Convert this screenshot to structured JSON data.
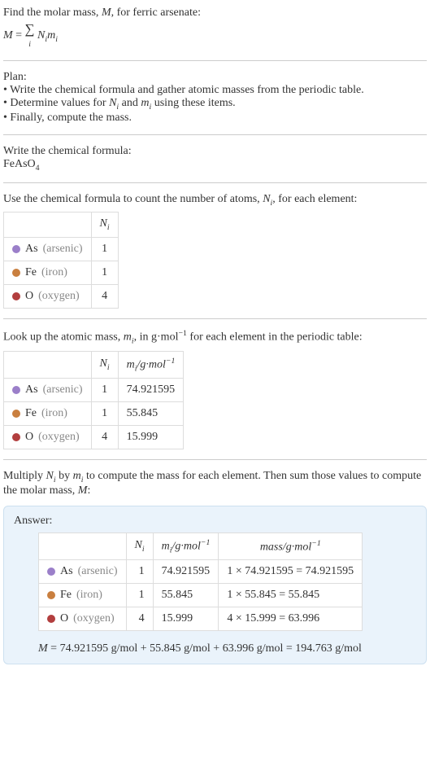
{
  "intro": {
    "title_pre": "Find the molar mass, ",
    "title_var": "M",
    "title_post": ", for ferric arsenate:",
    "eq_M": "M",
    "eq_eq": " = ",
    "eq_sigma": "∑",
    "eq_i": "i",
    "eq_Ni": "N",
    "eq_Ni_sub": "i",
    "eq_mi": "m",
    "eq_mi_sub": "i"
  },
  "plan": {
    "heading": "Plan:",
    "b1": "• Write the chemical formula and gather atomic masses from the periodic table.",
    "b2_pre": "• Determine values for ",
    "b2_N": "N",
    "b2_Ni": "i",
    "b2_mid": " and ",
    "b2_m": "m",
    "b2_mi": "i",
    "b2_post": " using these items.",
    "b3": "• Finally, compute the mass."
  },
  "formula": {
    "heading": "Write the chemical formula:",
    "fe": "FeAsO",
    "sub4": "4"
  },
  "count": {
    "text_pre": "Use the chemical formula to count the number of atoms, ",
    "text_N": "N",
    "text_i": "i",
    "text_post": ", for each element:",
    "col_N": "N",
    "col_i": "i",
    "rows": [
      {
        "el": "As",
        "name": "(arsenic)",
        "n": "1"
      },
      {
        "el": "Fe",
        "name": "(iron)",
        "n": "1"
      },
      {
        "el": "O",
        "name": "(oxygen)",
        "n": "4"
      }
    ]
  },
  "mass": {
    "text_pre": "Look up the atomic mass, ",
    "text_m": "m",
    "text_i": "i",
    "text_mid": ", in g·mol",
    "text_sup": "−1",
    "text_post": " for each element in the periodic table:",
    "col_N": "N",
    "col_Ni": "i",
    "col_m": "m",
    "col_mi": "i",
    "col_unit_pre": "/g·mol",
    "col_unit_sup": "−1",
    "rows": [
      {
        "el": "As",
        "name": "(arsenic)",
        "n": "1",
        "m": "74.921595"
      },
      {
        "el": "Fe",
        "name": "(iron)",
        "n": "1",
        "m": "55.845"
      },
      {
        "el": "O",
        "name": "(oxygen)",
        "n": "4",
        "m": "15.999"
      }
    ]
  },
  "multiply": {
    "text_pre": "Multiply ",
    "N": "N",
    "Ni": "i",
    "by": " by ",
    "m": "m",
    "mi": "i",
    "post": " to compute the mass for each element. Then sum those values to compute the molar mass, ",
    "Mvar": "M",
    "colon": ":"
  },
  "answer": {
    "heading": "Answer:",
    "col_N": "N",
    "col_Ni": "i",
    "col_m": "m",
    "col_mi": "i",
    "col_munit_pre": "/g·mol",
    "col_munit_sup": "−1",
    "col_mass_pre": "mass/g·mol",
    "col_mass_sup": "−1",
    "rows": [
      {
        "el": "As",
        "name": "(arsenic)",
        "n": "1",
        "m": "74.921595",
        "calc": "1 × 74.921595 = 74.921595"
      },
      {
        "el": "Fe",
        "name": "(iron)",
        "n": "1",
        "m": "55.845",
        "calc": "1 × 55.845 = 55.845"
      },
      {
        "el": "O",
        "name": "(oxygen)",
        "n": "4",
        "m": "15.999",
        "calc": "4 × 15.999 = 63.996"
      }
    ],
    "final_M": "M",
    "final_eq": " = 74.921595 g/mol + 55.845 g/mol + 63.996 g/mol = 194.763 g/mol"
  }
}
